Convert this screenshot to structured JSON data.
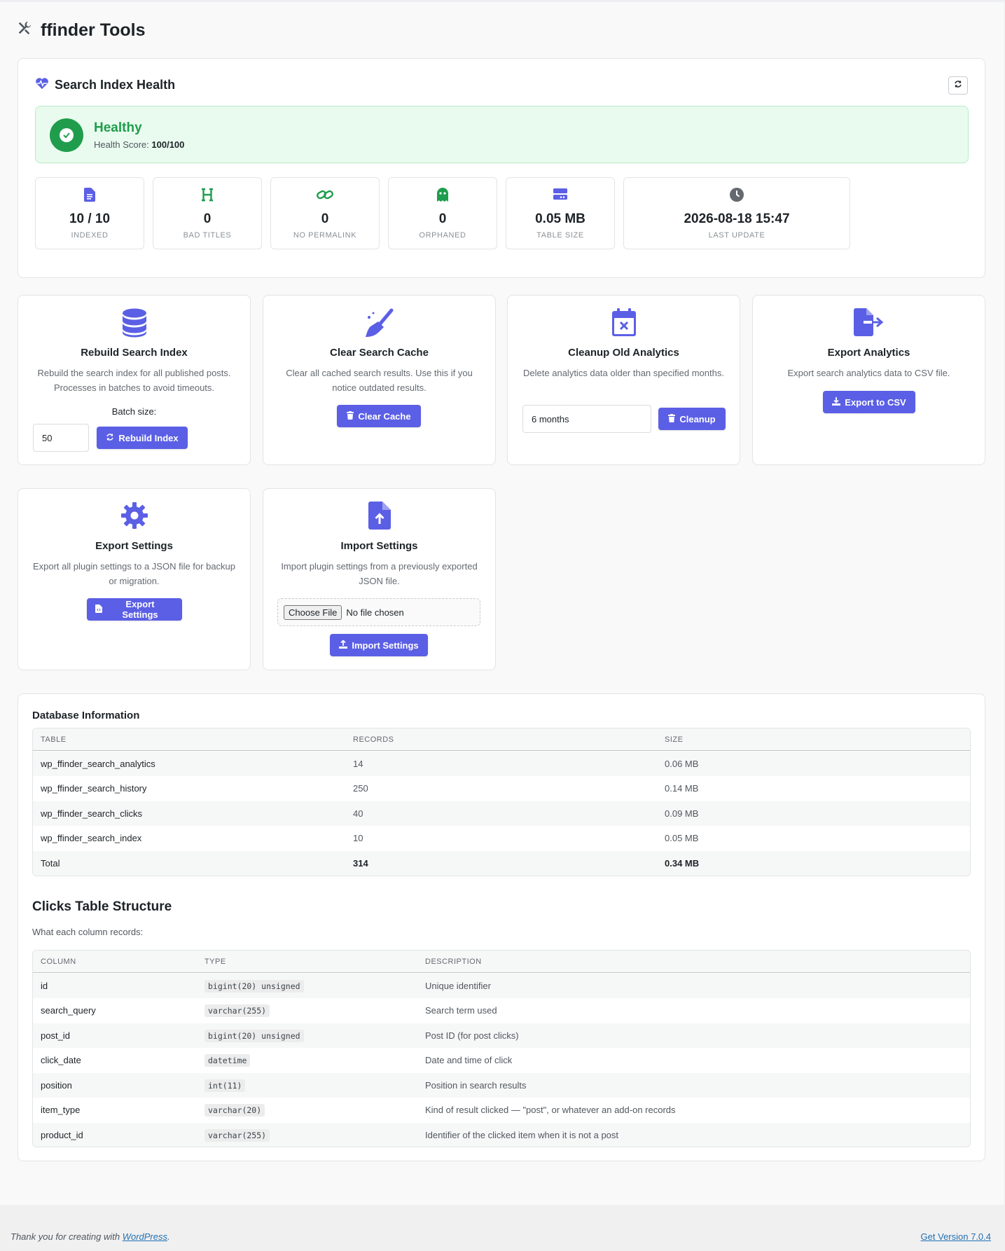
{
  "page": {
    "title": "ffinder Tools"
  },
  "health": {
    "title": "Search Index Health",
    "status_label": "Healthy",
    "score_prefix": "Health Score:",
    "score_value": "100/100",
    "stats": [
      {
        "icon": "file-icon",
        "value": "10 / 10",
        "label": "INDEXED"
      },
      {
        "icon": "heading-icon",
        "value": "0",
        "label": "BAD TITLES"
      },
      {
        "icon": "link-icon",
        "value": "0",
        "label": "NO PERMALINK"
      },
      {
        "icon": "ghost-icon",
        "value": "0",
        "label": "ORPHANED"
      },
      {
        "icon": "server-icon",
        "value": "0.05 MB",
        "label": "TABLE SIZE"
      },
      {
        "icon": "clock-icon",
        "value": "2026-08-18 15:47",
        "label": "LAST UPDATE"
      }
    ]
  },
  "tools": {
    "rebuild": {
      "title": "Rebuild Search Index",
      "desc": "Rebuild the search index for all published posts. Processes in batches to avoid timeouts.",
      "batch_label": "Batch size:",
      "batch_value": "50",
      "button": "Rebuild Index"
    },
    "cache": {
      "title": "Clear Search Cache",
      "desc": "Clear all cached search results. Use this if you notice outdated results.",
      "button": "Clear Cache"
    },
    "cleanup": {
      "title": "Cleanup Old Analytics",
      "desc": "Delete analytics data older than specified months.",
      "select_value": "6 months",
      "button": "Cleanup"
    },
    "export_analytics": {
      "title": "Export Analytics",
      "desc": "Export search analytics data to CSV file.",
      "button": "Export to CSV"
    },
    "export_settings": {
      "title": "Export Settings",
      "desc": "Export all plugin settings to a JSON file for backup or migration.",
      "button": "Export Settings"
    },
    "import_settings": {
      "title": "Import Settings",
      "desc": "Import plugin settings from a previously exported JSON file.",
      "choose_label": "Choose File",
      "no_file": "No file chosen",
      "button": "Import Settings"
    }
  },
  "database": {
    "title": "Database Information",
    "headers": [
      "TABLE",
      "RECORDS",
      "SIZE"
    ],
    "rows": [
      [
        "wp_ffinder_search_analytics",
        "14",
        "0.06 MB"
      ],
      [
        "wp_ffinder_search_history",
        "250",
        "0.14 MB"
      ],
      [
        "wp_ffinder_search_clicks",
        "40",
        "0.09 MB"
      ],
      [
        "wp_ffinder_search_index",
        "10",
        "0.05 MB"
      ]
    ],
    "total": [
      "Total",
      "314",
      "0.34 MB"
    ]
  },
  "clicks": {
    "title": "Clicks Table Structure",
    "subtitle": "What each column records:",
    "headers": [
      "COLUMN",
      "TYPE",
      "DESCRIPTION"
    ],
    "rows": [
      [
        "id",
        "bigint(20) unsigned",
        "Unique identifier"
      ],
      [
        "search_query",
        "varchar(255)",
        "Search term used"
      ],
      [
        "post_id",
        "bigint(20) unsigned",
        "Post ID (for post clicks)"
      ],
      [
        "click_date",
        "datetime",
        "Date and time of click"
      ],
      [
        "position",
        "int(11)",
        "Position in search results"
      ],
      [
        "item_type",
        "varchar(20)",
        "Kind of result clicked — \"post\", or whatever an add-on records"
      ],
      [
        "product_id",
        "varchar(255)",
        "Identifier of the clicked item when it is not a post"
      ]
    ]
  },
  "footer": {
    "thanks_prefix": "Thank you for creating with",
    "wordpress_link": "WordPress",
    "thanks_suffix": ".",
    "version_link": "Get Version 7.0.4"
  },
  "colors": {
    "accent": "#5b5fe5",
    "success": "#1f9d4c"
  }
}
